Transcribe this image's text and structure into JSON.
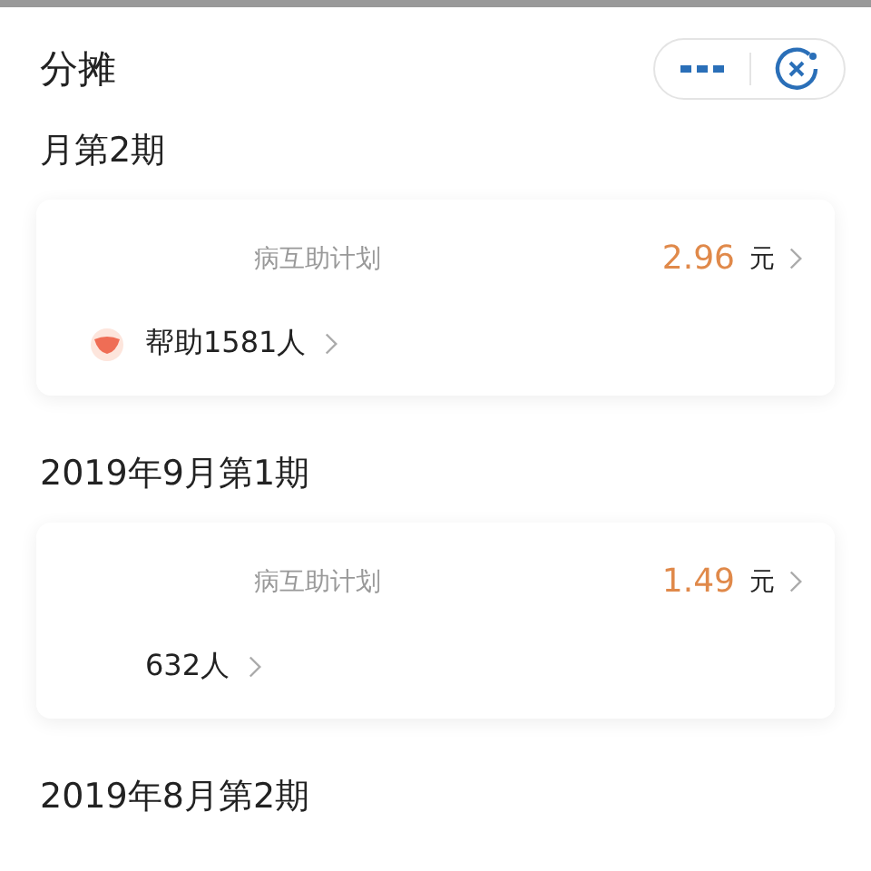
{
  "header": {
    "title": "分摊"
  },
  "periods": [
    {
      "title": "月第2期",
      "plan": "病互助计划",
      "amount": "2.96",
      "unit": "元",
      "helped": "帮助1581人",
      "heart": true
    },
    {
      "title": "2019年9月第1期",
      "plan": "病互助计划",
      "amount": "1.49",
      "unit": "元",
      "helped": "632人",
      "heart": false
    },
    {
      "title": "2019年8月第2期"
    }
  ]
}
